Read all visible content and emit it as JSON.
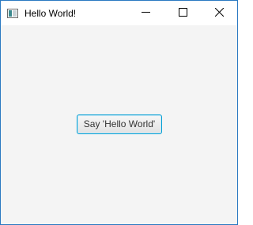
{
  "window": {
    "title": "Hello World!",
    "border_color": "#2b79c2",
    "background_color": "#f4f4f4",
    "controls": [
      {
        "name": "minimize",
        "icon": "minimize-icon"
      },
      {
        "name": "maximize",
        "icon": "maximize-icon"
      },
      {
        "name": "close",
        "icon": "close-icon"
      }
    ]
  },
  "app_icon": "java-app-icon",
  "main": {
    "button_label": "Say 'Hello World'",
    "button_focus_color": "#039ed3"
  }
}
